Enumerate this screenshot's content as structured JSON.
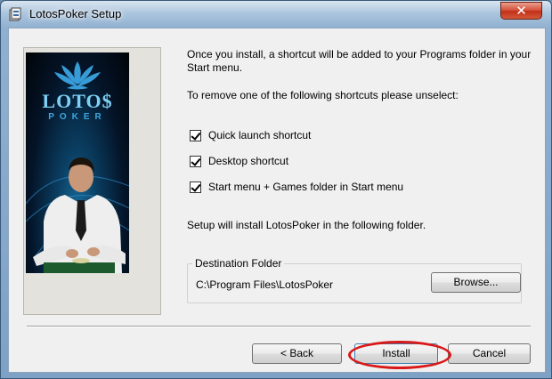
{
  "window": {
    "title": "LotosPoker Setup",
    "close_glyph": "✕"
  },
  "content": {
    "intro": "Once you install, a shortcut will be added to your Programs folder in your Start menu.",
    "remove_prompt": "To remove one of the following shortcuts please unselect:",
    "checkboxes": [
      {
        "label": "Quick launch shortcut",
        "checked": true
      },
      {
        "label": "Desktop shortcut",
        "checked": true
      },
      {
        "label": "Start menu + Games folder in Start menu",
        "checked": true
      }
    ],
    "install_folder_text": "Setup will install LotosPoker in the following folder."
  },
  "destination": {
    "legend": "Destination Folder",
    "path": "C:\\Program Files\\LotosPoker",
    "browse_label": "Browse..."
  },
  "banner": {
    "logo": "LOTO$",
    "subtitle": "POKER"
  },
  "buttons": {
    "back_label": "< Back",
    "install_label": "Install",
    "cancel_label": "Cancel"
  },
  "colors": {
    "highlight": "#d91818",
    "banner_accent": "#7fd0f5"
  },
  "icons": {
    "app": "setup-icon",
    "close": "close-icon",
    "lotus": "lotus-logo-icon"
  }
}
